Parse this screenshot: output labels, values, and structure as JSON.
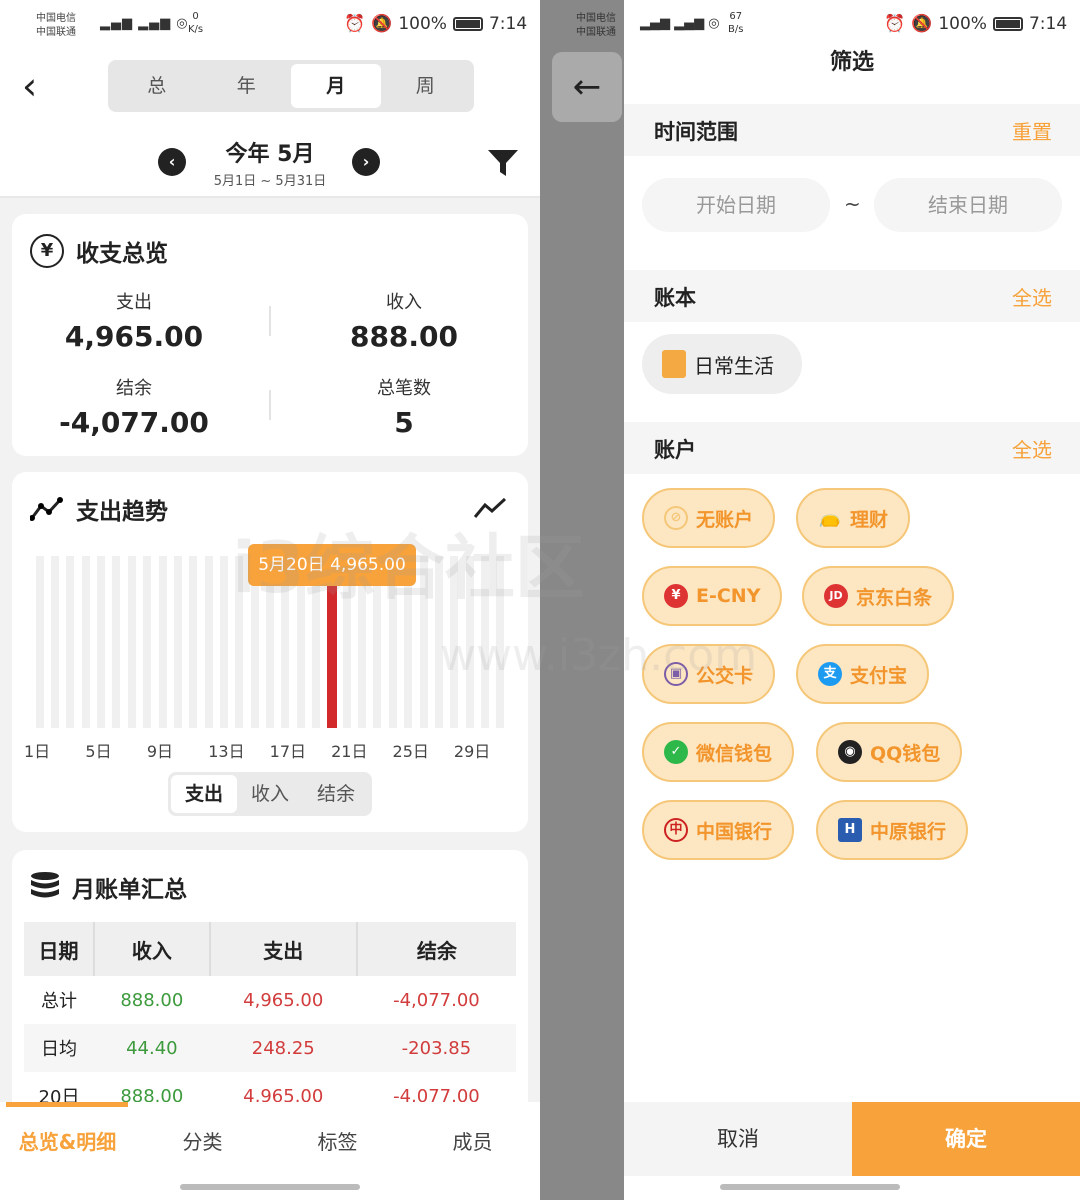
{
  "status_left": {
    "carrier1": "中国电信",
    "carrier2": "中国联通",
    "speed": "0",
    "speed_unit": "K/s",
    "battery": "100%",
    "time": "7:14"
  },
  "status_right": {
    "carrier1": "中国电信",
    "carrier2": "中国联通",
    "speed": "67",
    "speed_unit": "B/s",
    "battery": "100%",
    "time": "7:14"
  },
  "left": {
    "period_tabs": [
      "总",
      "年",
      "月",
      "周"
    ],
    "selected_tab": "月",
    "period_title": "今年 5月",
    "period_range": "5月1日 ~ 5月31日",
    "overview": {
      "title": "收支总览",
      "expense_label": "支出",
      "expense_value": "4,965.00",
      "income_label": "收入",
      "income_value": "888.00",
      "balance_label": "结余",
      "balance_value": "-4,077.00",
      "count_label": "总笔数",
      "count_value": "5"
    },
    "trend": {
      "title": "支出趋势",
      "tooltip": "5月20日 4,965.00",
      "toggle": [
        "支出",
        "收入",
        "结余"
      ],
      "toggle_selected": "支出"
    },
    "summary": {
      "title": "月账单汇总",
      "headers": [
        "日期",
        "收入",
        "支出",
        "结余"
      ],
      "rows": [
        [
          "总计",
          "888.00",
          "4,965.00",
          "-4,077.00"
        ],
        [
          "日均",
          "44.40",
          "248.25",
          "-203.85"
        ],
        [
          "20日",
          "888.00",
          "4,965.00",
          "-4,077.00"
        ]
      ]
    },
    "bottom_tabs": [
      "总览&明细",
      "分类",
      "标签",
      "成员"
    ],
    "bottom_selected": "总览&明细"
  },
  "chart_data": {
    "type": "bar",
    "x": [
      1,
      2,
      3,
      4,
      5,
      6,
      7,
      8,
      9,
      10,
      11,
      12,
      13,
      14,
      15,
      16,
      17,
      18,
      19,
      20,
      21,
      22,
      23,
      24,
      25,
      26,
      27,
      28,
      29,
      30,
      31
    ],
    "values": [
      0,
      0,
      0,
      0,
      0,
      0,
      0,
      0,
      0,
      0,
      0,
      0,
      0,
      0,
      0,
      0,
      0,
      0,
      0,
      4965,
      0,
      0,
      0,
      0,
      0,
      0,
      0,
      0,
      0,
      0,
      0
    ],
    "tick_labels": [
      "1日",
      "5日",
      "9日",
      "13日",
      "17日",
      "21日",
      "25日",
      "29日"
    ],
    "tick_positions": [
      1,
      5,
      9,
      13,
      17,
      21,
      25,
      29
    ],
    "highlight": {
      "x": 20,
      "color": "#d22a2a"
    }
  },
  "right": {
    "title": "筛选",
    "time_section": "时间范围",
    "time_action": "重置",
    "start_placeholder": "开始日期",
    "end_placeholder": "结束日期",
    "separator": "~",
    "book_section": "账本",
    "book_action": "全选",
    "book_item": "日常生活",
    "account_section": "账户",
    "account_action": "全选",
    "accounts": [
      "无账户",
      "理财",
      "E-CNY",
      "京东白条",
      "公交卡",
      "支付宝",
      "微信钱包",
      "QQ钱包",
      "中国银行",
      "中原银行"
    ],
    "cancel": "取消",
    "confirm": "确定"
  },
  "watermark": {
    "cn": "i3综合社区",
    "url": "www.i3zh.com"
  },
  "colors": {
    "accent": "#f7a23b",
    "income": "#3d9a3d",
    "expense": "#d23c3c"
  }
}
